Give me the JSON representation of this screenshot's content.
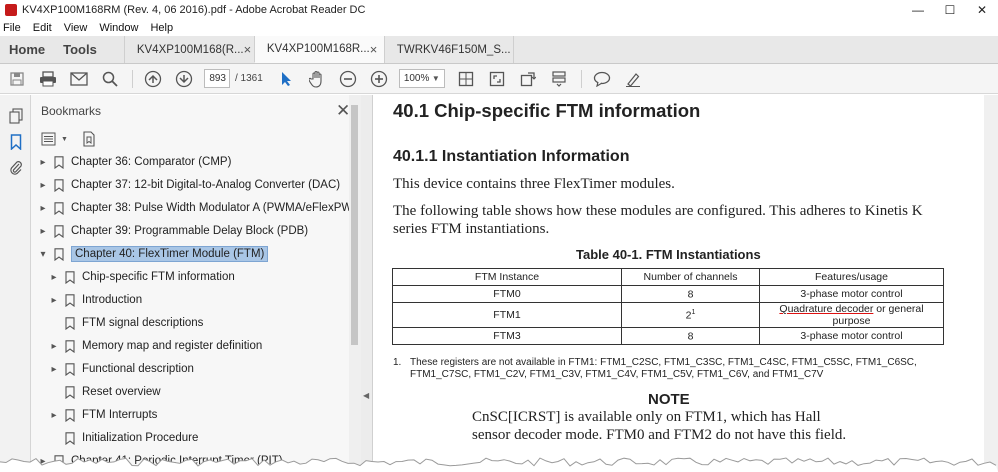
{
  "window": {
    "title": "KV4XP100M168RM (Rev. 4, 06 2016).pdf - Adobe Acrobat Reader DC",
    "controls": [
      "—",
      "☐",
      "✕"
    ]
  },
  "menubar": [
    "File",
    "Edit",
    "View",
    "Window",
    "Help"
  ],
  "tabs": {
    "home": "Home",
    "tools": "Tools",
    "documents": [
      {
        "label": "KV4XP100M168(R...",
        "close": "×"
      },
      {
        "label": "KV4XP100M168R...",
        "close": "×"
      },
      {
        "label": "TWRKV46F150M_S...",
        "close": ""
      }
    ]
  },
  "toolbar": {
    "page_current": "893",
    "page_total": "/  1361",
    "zoom": "100%",
    "icons": [
      "save-icon",
      "print-icon",
      "email-icon",
      "search-icon",
      "page-up-icon",
      "page-down-icon",
      "select-arrow-icon",
      "hand-icon",
      "zoom-out-icon",
      "zoom-in-icon",
      "fit-page-icon",
      "fullscreen-icon",
      "rotate-icon",
      "scroll-mode-icon",
      "comment-icon",
      "highlight-pen-icon"
    ]
  },
  "bookmarks": {
    "title": "Bookmarks",
    "items": [
      {
        "label": "Chapter 36: Comparator (CMP)",
        "level": 0,
        "expand": "▸"
      },
      {
        "label": "Chapter 37: 12-bit Digital-to-Analog Converter (DAC)",
        "level": 0,
        "expand": "▸"
      },
      {
        "label": "Chapter 38: Pulse Width Modulator A (PWMA/eFlexPWM)",
        "level": 0,
        "expand": "▸"
      },
      {
        "label": "Chapter 39: Programmable Delay Block (PDB)",
        "level": 0,
        "expand": "▸"
      },
      {
        "label": "Chapter 40: FlexTimer Module (FTM)",
        "level": 0,
        "expand": "▾",
        "selected": true
      },
      {
        "label": "Chip-specific FTM information",
        "level": 1,
        "expand": "▸"
      },
      {
        "label": "Introduction",
        "level": 1,
        "expand": "▸"
      },
      {
        "label": "FTM signal descriptions",
        "level": 1,
        "expand": ""
      },
      {
        "label": "Memory map and register definition",
        "level": 1,
        "expand": "▸"
      },
      {
        "label": "Functional description",
        "level": 1,
        "expand": "▸"
      },
      {
        "label": "Reset overview",
        "level": 1,
        "expand": ""
      },
      {
        "label": "FTM Interrupts",
        "level": 1,
        "expand": "▸"
      },
      {
        "label": "Initialization Procedure",
        "level": 1,
        "expand": ""
      },
      {
        "label": "Chapter 41: Periodic Interrupt Timer (PIT)",
        "level": 0,
        "expand": "▸"
      }
    ]
  },
  "document": {
    "h1": "40.1   Chip-specific FTM information",
    "h2": "40.1.1   Instantiation Information",
    "para1": "This device contains three FlexTimer modules.",
    "para2_line1": "The following table shows how these modules are configured. This adheres to Kinetis K",
    "para2_line2": "series FTM instantiations.",
    "table_caption": "Table 40-1.  FTM Instantiations",
    "table_headers": [
      "FTM Instance",
      "Number of channels",
      "Features/usage"
    ],
    "table_rows": [
      {
        "instance": "FTM0",
        "channels": "8",
        "sup": "",
        "usage_a": "",
        "usage_b": "3-phase motor control"
      },
      {
        "instance": "FTM1",
        "channels": "2",
        "sup": "1",
        "usage_a": "Quadrature decoder",
        "usage_b": " or general purpose"
      },
      {
        "instance": "FTM3",
        "channels": "8",
        "sup": "",
        "usage_a": "",
        "usage_b": "3-phase motor control"
      }
    ],
    "footnote_num": "1.",
    "footnote_text": "These registers are not available in FTM1: FTM1_C2SC, FTM1_C3SC, FTM1_C4SC, FTM1_C5SC, FTM1_C6SC, FTM1_C7SC, FTM1_C2V, FTM1_C3V, FTM1_C4V, FTM1_C5V, FTM1_C6V, and FTM1_C7V",
    "note_heading": "NOTE",
    "note_line1": "CnSC[ICRST] is available only on FTM1, which has Hall",
    "note_line2": "sensor decoder mode. FTM0 and FTM2 do not have this field."
  },
  "colors": {
    "selection": "#a9c6e6",
    "acrobat_red": "#c51b1b",
    "annotation_underline": "#dd1111"
  }
}
